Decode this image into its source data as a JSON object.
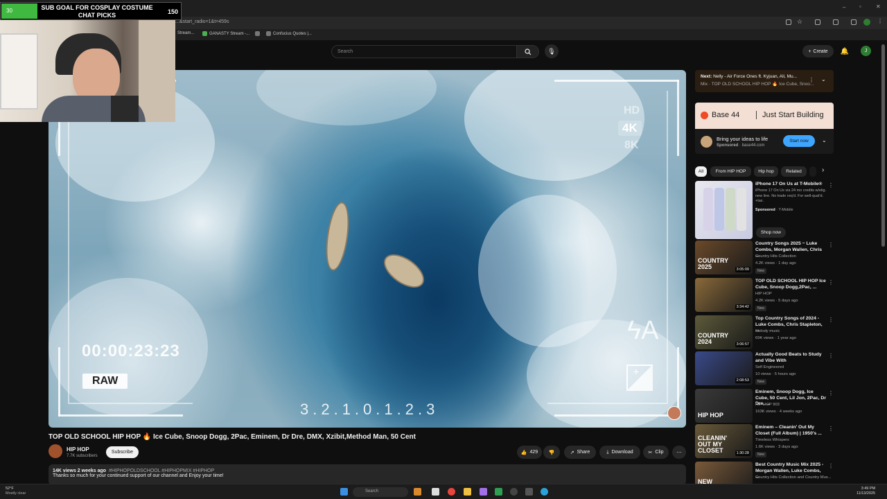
{
  "overlay": {
    "sub_goal": {
      "title": "SUB GOAL FOR COSPLAY COSTUME CHAT PICKS",
      "current": "30",
      "target": "150",
      "progress": 0.2
    }
  },
  "browser": {
    "url": "...&start_radio=1&t=459s",
    "bookmarks": [
      "Stream...",
      "GANASTY Stream -...",
      "Confucius Quotes |..."
    ]
  },
  "header": {
    "search_placeholder": "Search",
    "create_label": "Create",
    "avatar_letter": "J"
  },
  "video": {
    "title": "TOP OLD SCHOOL HIP HOP 🔥 Ice Cube, Snoop Dogg, 2Pac, Eminem, Dr Dre, DMX, Xzibit,Method Man, 50 Cent",
    "hud": {
      "hd": "HD",
      "k4": "4K",
      "k8": "8K",
      "timecode": "00:00:23:23",
      "raw": "RAW",
      "scale": "3.2.1.0.1.2.3",
      "flash": "ϟA",
      "exposure": "+"
    }
  },
  "channel": {
    "name": "HIP HOP",
    "subscribers": "7.7K subscribers",
    "subscribe_label": "Subscribe"
  },
  "actions": {
    "likes": "429",
    "share": "Share",
    "download": "Download",
    "clip": "Clip"
  },
  "description": {
    "meta": "14K views  2 weeks ago",
    "tags": "#HIPHOPOLDSCHOOL #HIPHOPMIX #HIPHOP",
    "text": "Thanks so much for your continued support of our channel and Enjoy your time!"
  },
  "next_up": {
    "label": "Next:",
    "title": "Nelly - Air Force Ones ft. Kyjuan, Ali, Mu...",
    "subtitle": "Mix · TOP OLD SCHOOL HIP HOP 🔥 Ice Cube, Snoo..."
  },
  "ad": {
    "brand": "Base 44",
    "tagline": "Just Start Building",
    "title": "Bring your ideas to life",
    "sponsored": "Sponsored",
    "domain": "base44.com",
    "cta": "Start now"
  },
  "chips": [
    "All",
    "From HIP HOP",
    "Hip hop",
    "Related"
  ],
  "promo": {
    "title": "iPhone 17 On Us at T-Mobile®",
    "text": "iPhone 17 On Us via 24 mo credits w/elig. new line. No trade req'd. For well-qual'd. +tax.",
    "sponsored": "Sponsored",
    "advertiser": "T-Mobile",
    "cta": "Shop now"
  },
  "recommendations": [
    {
      "title": "Country Songs 2025 ~ Luke Combs, Morgan Wallen, Chris ...",
      "channel": "Country Hits Collection",
      "meta": "4.2K views · 1 day ago",
      "badge": "New",
      "duration": "3:05:09",
      "thumb_text": "COUNTRY 2025",
      "thumb_color": "#6b4a2a"
    },
    {
      "title": "TOP OLD SCHOOL HIP HOP Ice Cube, Snoop Dogg,2Pac, ...",
      "channel": "HIP HOP",
      "meta": "4.2K views · 5 days ago",
      "badge": "New",
      "duration": "3:34:42",
      "thumb_text": "",
      "thumb_color": "#8a6a3a"
    },
    {
      "title": "Top Country Songs of 2024 - Luke Combs, Chris Stapleton, ...",
      "channel": "Melody music",
      "meta": "69K views · 1 year ago",
      "badge": "",
      "duration": "3:06:57",
      "thumb_text": "COUNTRY 2024",
      "thumb_color": "#5d5a3a"
    },
    {
      "title": "Actually Good Beats to Study and Vibe With",
      "channel": "Self Engineered",
      "meta": "10 views · 5 hours ago",
      "badge": "New",
      "duration": "2:08:53",
      "thumb_text": "",
      "thumb_color": "#3a4a8a"
    },
    {
      "title": "Eminem, Snoop Dogg, Ice Cube, 50 Cent, Lil Jon, 2Pac, Dr Dre, ...",
      "channel": "HIP HOP 903",
      "meta": "163K views · 4 weeks ago",
      "badge": "",
      "duration": "",
      "thumb_text": "HIP HOP",
      "thumb_color": "#3a3a3a"
    },
    {
      "title": "Eminem – Cleanin' Out My Closet (Full Album) | 1950's ...",
      "channel": "Timeless Whispers",
      "meta": "1.6K views · 3 days ago",
      "badge": "New",
      "duration": "1:30:28",
      "thumb_text": "CLEANIN' OUT MY CLOSET",
      "thumb_color": "#6a5a3a"
    },
    {
      "title": "Best Country Music Mix 2025 - Morgan Wallen, Luke Combs, ...",
      "channel": "Country Hits Collection and Country Mus...",
      "meta": "",
      "badge": "",
      "duration": "",
      "thumb_text": "NEW COUNTRY",
      "thumb_color": "#7a5a3a"
    }
  ],
  "taskbar": {
    "weather_temp": "52°F",
    "weather_desc": "Mostly clear",
    "search": "Search",
    "time": "3:49 PM",
    "date": "11/13/2025"
  }
}
